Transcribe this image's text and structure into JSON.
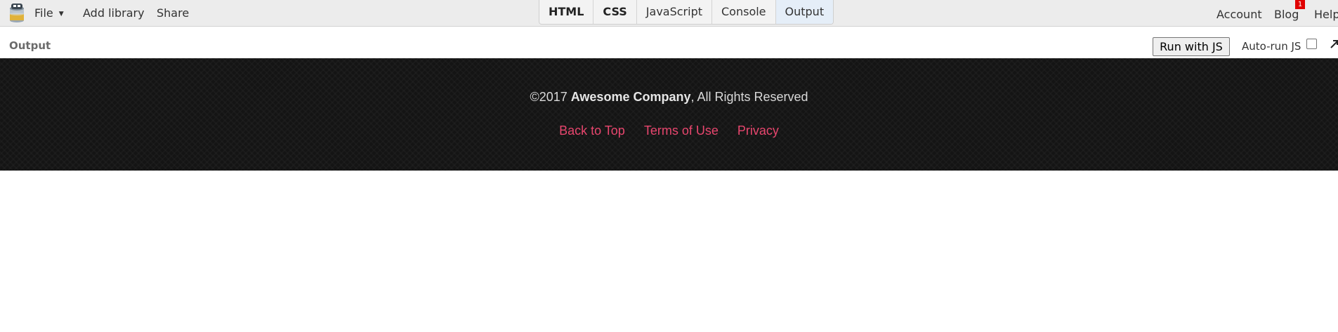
{
  "toolbar": {
    "file_label": "File",
    "file_caret": "▼",
    "add_library_label": "Add library",
    "share_label": "Share",
    "account_label": "Account",
    "blog_label": "Blog",
    "blog_badge_count": "1",
    "help_label": "Help"
  },
  "tabs": [
    {
      "label": "HTML",
      "bold": true,
      "active": false
    },
    {
      "label": "CSS",
      "bold": true,
      "active": false
    },
    {
      "label": "JavaScript",
      "bold": false,
      "active": false
    },
    {
      "label": "Console",
      "bold": false,
      "active": false
    },
    {
      "label": "Output",
      "bold": false,
      "active": true
    }
  ],
  "output_panel": {
    "title": "Output",
    "run_button_label": "Run with JS",
    "autorun_label": "Auto-run JS",
    "autorun_checked": false
  },
  "footer": {
    "copyright_prefix": "©2017 ",
    "company": "Awesome Company",
    "copyright_suffix": ", All Rights Reserved",
    "links": [
      {
        "label": "Back to Top"
      },
      {
        "label": "Terms of Use"
      },
      {
        "label": "Privacy"
      }
    ],
    "link_color": "#e8466e",
    "background_color": "#141414"
  },
  "icons": {
    "logo": "jsbin-logo-icon",
    "expand": "expand-arrow-icon"
  }
}
